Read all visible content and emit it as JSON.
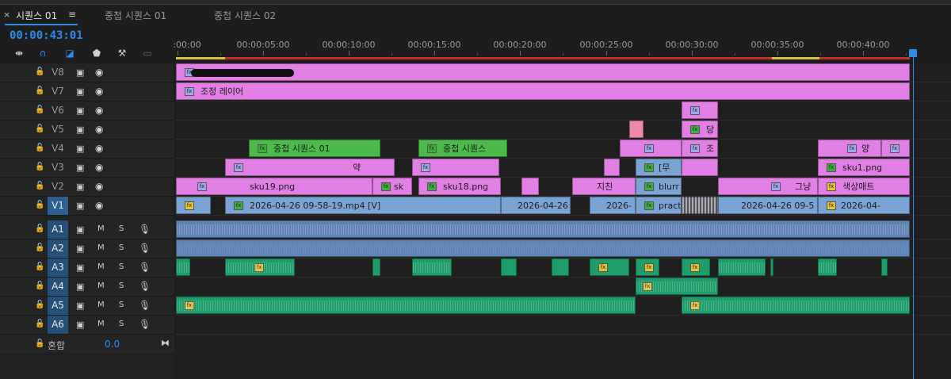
{
  "tabs": [
    {
      "label": "시퀀스 01",
      "active": true
    },
    {
      "label": "중첩 시퀀스 01",
      "active": false
    },
    {
      "label": "중첩 시퀀스 02",
      "active": false
    }
  ],
  "timecode": "00:00:43:01",
  "ruler": {
    "labels": [
      ":00:00",
      "00:00:05:00",
      "00:00:10:00",
      "00:00:15:00",
      "00:00:20:00",
      "00:00:25:00",
      "00:00:30:00",
      "00:00:35:00",
      "00:00:40:00"
    ]
  },
  "video_tracks": [
    "V8",
    "V7",
    "V6",
    "V5",
    "V4",
    "V3",
    "V2",
    "V1"
  ],
  "audio_tracks": [
    "A1",
    "A2",
    "A3",
    "A4",
    "A5",
    "A6"
  ],
  "mix": {
    "label": "혼합",
    "value": "0.0"
  },
  "clips": {
    "v7_adjust": "조정 레이어",
    "v5_dang": "당",
    "v4_nest1": "중첩 시퀀스 01",
    "v4_nest2": "중첩 시퀀스",
    "v4_jo": "조",
    "v4_yang": "양",
    "v3_yak": "약",
    "v3_mu": "[무",
    "v3_sku1": "sku1.png",
    "v2_sku19": "sku19.png",
    "v2_sk": "sk",
    "v2_sku18": "sku18.png",
    "v2_jichin": "지친",
    "v2_blurr": "blurr",
    "v2_geunyang": "그냥",
    "v2_color": "색상매트",
    "v1_mp4": "2026-04-26 09-58-19.mp4 [V]",
    "v1_date1": "2026-04-26",
    "v1_date2": "2026-",
    "v1_pract": "pract",
    "v1_date3": "2026-04-26 09-5",
    "v1_date4": "2026-04-"
  },
  "colors": {
    "accent": "#2d8ceb",
    "video_clip": "#e27fe4",
    "nest_clip": "#4cbb4c",
    "media_clip": "#7aa4d4",
    "audio_clip": "#1f9e6c"
  }
}
